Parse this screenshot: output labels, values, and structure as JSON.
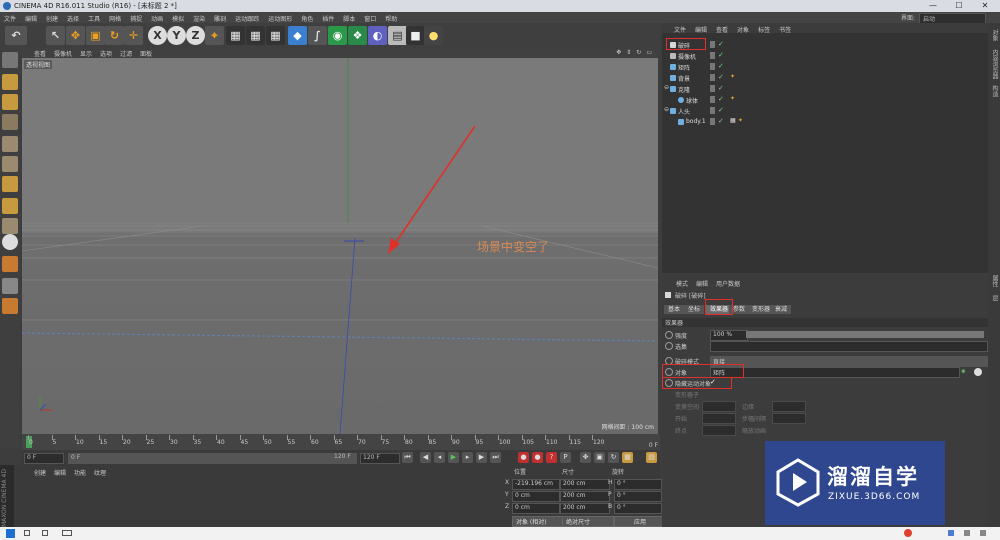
{
  "window": {
    "title": "CINEMA 4D R16.011 Studio (R16) - [未标题 2 *]",
    "controls": [
      "—",
      "☐",
      "✕"
    ]
  },
  "menu": {
    "items": [
      "文件",
      "编辑",
      "创建",
      "选择",
      "工具",
      "网格",
      "捕捉",
      "动画",
      "模拟",
      "渲染",
      "雕刻",
      "运动跟踪",
      "运动图形",
      "角色",
      "插件",
      "脚本",
      "窗口",
      "帮助"
    ],
    "layout_label": "界面:",
    "layout_value": "启动"
  },
  "toolbar": {
    "axis_x": "X",
    "axis_y": "Y",
    "axis_z": "Z"
  },
  "viewport": {
    "menu": [
      "查看",
      "摄像机",
      "显示",
      "选项",
      "过滤",
      "面板"
    ],
    "view_label": "透视视图",
    "grid_spacing": "网格间距 : 100 cm",
    "annotation": "场景中变空了"
  },
  "timeline": {
    "ticks": [
      "0",
      "5",
      "10",
      "15",
      "20",
      "25",
      "30",
      "35",
      "40",
      "45",
      "50",
      "55",
      "60",
      "65",
      "70",
      "75",
      "80",
      "85",
      "90",
      "95",
      "100",
      "105",
      "110",
      "115",
      "120"
    ],
    "end_label": "0 F",
    "current_frame": "0 F",
    "start_frame": "0 F",
    "end_frame": "120 F",
    "end_frame2": "120 F"
  },
  "materials": {
    "menu": [
      "创建",
      "编辑",
      "功能",
      "纹理"
    ],
    "maxon": "MAXON CINEMA 4D"
  },
  "coords": {
    "headers": [
      "位置",
      "尺寸",
      "旋转"
    ],
    "rows": [
      {
        "axis": "X",
        "pos": "-219.196 cm",
        "size": "200 cm",
        "rl": "H",
        "rot": "0 °"
      },
      {
        "axis": "Y",
        "pos": "0 cm",
        "size": "200 cm",
        "rl": "P",
        "rot": "0 °"
      },
      {
        "axis": "Z",
        "pos": "0 cm",
        "size": "200 cm",
        "rl": "B",
        "rot": "0 °"
      }
    ],
    "mode1": "对象 (相对)",
    "mode2": "绝对尺寸",
    "apply": "应用"
  },
  "objects": {
    "tabs": [
      "文件",
      "编辑",
      "查看",
      "对象",
      "标签",
      "书签"
    ],
    "items": [
      {
        "name": "破碎",
        "indent": 0,
        "color": "#d8d8d8"
      },
      {
        "name": "摄像机",
        "indent": 0,
        "color": "#bbbbbb"
      },
      {
        "name": "矩阵",
        "indent": 0,
        "color": "#6fb0e0"
      },
      {
        "name": "背景",
        "indent": 0,
        "color": "#6fb0e0"
      },
      {
        "name": "克隆",
        "indent": 0,
        "color": "#6fb0e0"
      },
      {
        "name": "球体",
        "indent": 1,
        "color": "#6fb0e0"
      },
      {
        "name": "人头",
        "indent": 0,
        "color": "#6fb0e0"
      },
      {
        "name": "body.1",
        "indent": 1,
        "color": "#6fb0e0"
      }
    ]
  },
  "attributes": {
    "menu": [
      "模式",
      "编辑",
      "用户数据"
    ],
    "object_title": "破碎 [破碎]",
    "tabs": [
      "基本",
      "坐标",
      "效果器",
      "参数",
      "变形器",
      "衰减"
    ],
    "section": "效果器",
    "strength_label": "强度",
    "strength_value": "100 %",
    "select_label": "选集",
    "mode_label": "破碎模式",
    "mode_value": "直接",
    "object_label": "对象",
    "object_value": "矩阵",
    "hide_label": "隐藏运动对象",
    "hide_value": "✓",
    "dim_rows": [
      "变形器子",
      "变换空间",
      "开始",
      "终点",
      "边缘",
      "步幅间隔",
      "缩放动画"
    ]
  },
  "rightstrip": [
    "对象",
    "内容浏览器",
    "构造",
    "属性",
    "层"
  ],
  "watermark": {
    "brand": "溜溜自学",
    "url": "ZIXUE.3D66.COM"
  },
  "colors": {
    "accent_red": "#e0302a",
    "watermark_blue": "#2e4896",
    "annotation": "#d98a55"
  }
}
